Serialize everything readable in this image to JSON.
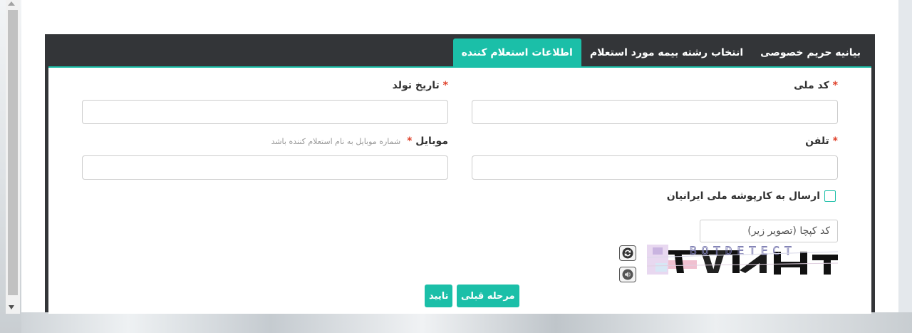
{
  "tabs": [
    {
      "label": "بیانیه حریم خصوصی"
    },
    {
      "label": "انتخاب رشته بیمه مورد استعلام"
    },
    {
      "label": "اطلاعات استعلام کننده"
    }
  ],
  "form": {
    "national_code": {
      "label": "کد ملی",
      "value": "",
      "required_mark": "*"
    },
    "birth_date": {
      "label": "تاریخ تولد",
      "value": "",
      "required_mark": "*"
    },
    "phone": {
      "label": "تلفن",
      "value": "",
      "required_mark": "*"
    },
    "mobile": {
      "label": "موبایل",
      "value": "",
      "required_mark": "*",
      "hint": "شماره موبایل به نام استعلام کننده باشد"
    },
    "send_to_kartpooshe": {
      "label": "ارسال به کارپوشه ملی ایرانیان",
      "checked": false
    },
    "captcha": {
      "placeholder": "کد کپچا (تصویر زیر)",
      "value": "",
      "image_text": "BOTDETECT"
    }
  },
  "buttons": {
    "prev_label": "مرحله قبلی",
    "confirm_label": "تایید"
  },
  "colors": {
    "accent": "#1bbfa8",
    "panel_dark": "#333538",
    "required": "#e0432c"
  },
  "icons": {
    "captcha_reload": "reload-icon",
    "captcha_sound": "speaker-icon"
  }
}
